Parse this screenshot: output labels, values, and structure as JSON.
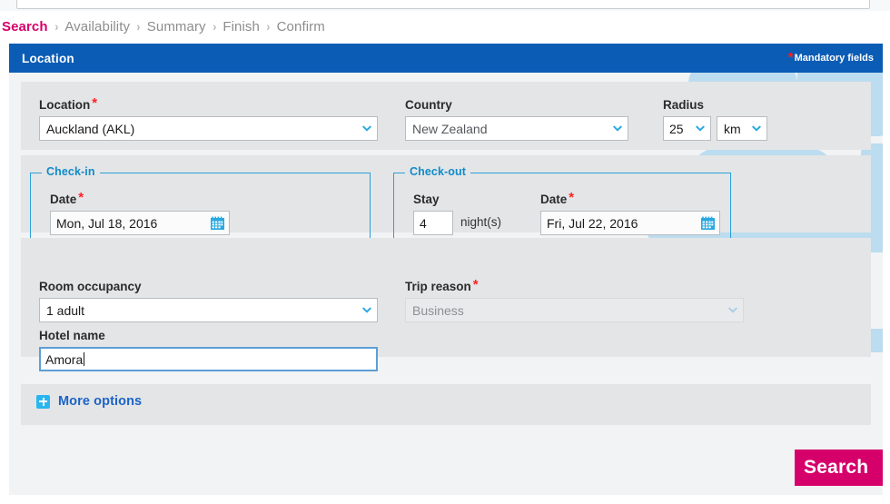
{
  "breadcrumb": {
    "separator": "›",
    "items": [
      {
        "label": "Search",
        "active": true
      },
      {
        "label": "Availability",
        "active": false
      },
      {
        "label": "Summary",
        "active": false
      },
      {
        "label": "Finish",
        "active": false
      },
      {
        "label": "Confirm",
        "active": false
      }
    ]
  },
  "panel": {
    "title": "Location",
    "mandatory_note": "Mandatory fields",
    "mandatory_star": "*"
  },
  "fields": {
    "location": {
      "label": "Location",
      "required_star": "*",
      "value": "Auckland (AKL)"
    },
    "country": {
      "label": "Country",
      "value": "New Zealand"
    },
    "radius": {
      "label": "Radius",
      "value": "25",
      "unit": "km"
    },
    "checkin": {
      "legend": "Check-in",
      "date_label": "Date",
      "required_star": "*",
      "date_value": "Mon, Jul 18, 2016"
    },
    "checkout": {
      "legend": "Check-out",
      "stay_label": "Stay",
      "stay_value": "4",
      "nights_label": "night(s)",
      "date_label": "Date",
      "required_star": "*",
      "date_value": "Fri, Jul 22, 2016"
    },
    "room_occupancy": {
      "label": "Room occupancy",
      "value": "1 adult"
    },
    "trip_reason": {
      "label": "Trip reason",
      "required_star": "*",
      "value": "Business",
      "disabled": true
    },
    "hotel_name": {
      "label": "Hotel name",
      "value": "Amora",
      "focused": true
    }
  },
  "more_options": {
    "label": "More options",
    "icon": "plus-box-icon"
  },
  "actions": {
    "search_label": "Search"
  },
  "colors": {
    "header_blue": "#0b5cb5",
    "accent_pink": "#d6006b",
    "fieldset_cyan": "#2aa0d8",
    "legend_blue": "#0f8cc9",
    "link_blue": "#1b63c6",
    "band_grey": "#e4e5e7",
    "panel_grey": "#f2f3f4",
    "required_red": "#ff2020",
    "watermark_blue": "#bcdcef"
  }
}
